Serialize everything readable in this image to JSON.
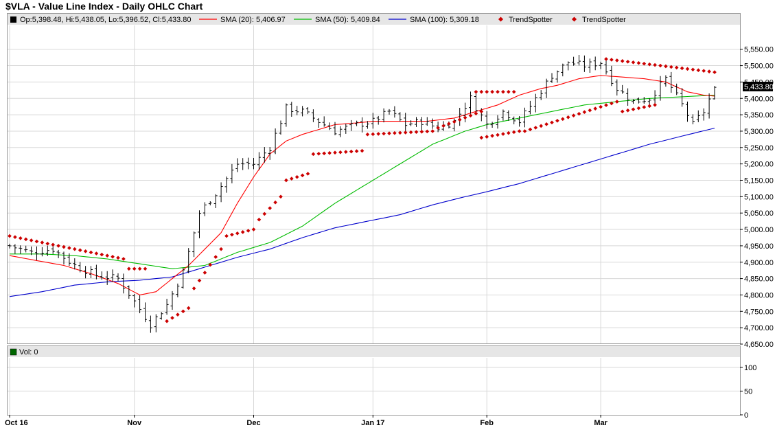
{
  "title": "$VLA - Value Line Index - Daily OHLC Chart",
  "colors": {
    "sma20": "#ff0000",
    "sma50": "#00bb00",
    "sma100": "#0000cc",
    "trendspotter": "#cc0000",
    "ohlc": "#000000",
    "grid": "#d8d8d8",
    "legend_bg": "#e6e6e6",
    "last_badge": "#000000"
  },
  "legend": {
    "ohlc": "Op:5,398.48, Hi:5,438.05, Lo:5,396.52, Cl:5,433.80",
    "sma20": "SMA (20): 5,406.97",
    "sma50": "SMA (50): 5,409.84",
    "sma100": "SMA (100): 5,309.18",
    "trend1": "TrendSpotter",
    "trend2": "TrendSpotter"
  },
  "volume_legend": "Vol: 0",
  "last_price_label": "5,433.80",
  "chart_data": {
    "type": "line",
    "price_axis": {
      "ylim": [
        4650,
        5600
      ],
      "ticks": [
        "4,650.00",
        "4,700.00",
        "4,750.00",
        "4,800.00",
        "4,850.00",
        "4,900.00",
        "4,950.00",
        "5,000.00",
        "5,050.00",
        "5,100.00",
        "5,150.00",
        "5,200.00",
        "5,250.00",
        "5,300.00",
        "5,350.00",
        "5,400.00",
        "5,450.00",
        "5,500.00",
        "5,550.00"
      ]
    },
    "volume_axis": {
      "ylim": [
        0,
        120
      ],
      "ticks": [
        "0",
        "50",
        "100"
      ]
    },
    "x_months": [
      {
        "label": "Oct 16",
        "bar": 0
      },
      {
        "label": "Nov",
        "bar": 23
      },
      {
        "label": "Dec",
        "bar": 45
      },
      {
        "label": "Jan 17",
        "bar": 67
      },
      {
        "label": "Feb",
        "bar": 88
      },
      {
        "label": "Mar",
        "bar": 109
      }
    ],
    "bar_count": 131,
    "close_anchors": [
      [
        0,
        4950
      ],
      [
        4,
        4930
      ],
      [
        8,
        4940
      ],
      [
        12,
        4890
      ],
      [
        16,
        4860
      ],
      [
        20,
        4850
      ],
      [
        23,
        4780
      ],
      [
        26,
        4710
      ],
      [
        29,
        4770
      ],
      [
        32,
        4870
      ],
      [
        35,
        5050
      ],
      [
        38,
        5110
      ],
      [
        42,
        5200
      ],
      [
        45,
        5200
      ],
      [
        48,
        5250
      ],
      [
        51,
        5370
      ],
      [
        54,
        5360
      ],
      [
        57,
        5330
      ],
      [
        60,
        5300
      ],
      [
        64,
        5320
      ],
      [
        67,
        5330
      ],
      [
        70,
        5360
      ],
      [
        73,
        5320
      ],
      [
        76,
        5330
      ],
      [
        79,
        5310
      ],
      [
        82,
        5330
      ],
      [
        85,
        5400
      ],
      [
        88,
        5320
      ],
      [
        91,
        5360
      ],
      [
        94,
        5330
      ],
      [
        97,
        5400
      ],
      [
        100,
        5470
      ],
      [
        103,
        5510
      ],
      [
        106,
        5500
      ],
      [
        109,
        5510
      ],
      [
        112,
        5430
      ],
      [
        115,
        5390
      ],
      [
        118,
        5400
      ],
      [
        121,
        5460
      ],
      [
        124,
        5380
      ],
      [
        126,
        5320
      ],
      [
        128,
        5360
      ],
      [
        130,
        5433.8
      ]
    ],
    "sma20": {
      "name": "SMA (20)",
      "values": [
        [
          0,
          4920
        ],
        [
          5,
          4905
        ],
        [
          10,
          4890
        ],
        [
          15,
          4865
        ],
        [
          20,
          4835
        ],
        [
          24,
          4800
        ],
        [
          27,
          4810
        ],
        [
          30,
          4850
        ],
        [
          33,
          4890
        ],
        [
          36,
          4940
        ],
        [
          39,
          4990
        ],
        [
          42,
          5080
        ],
        [
          45,
          5160
        ],
        [
          48,
          5230
        ],
        [
          51,
          5270
        ],
        [
          54,
          5290
        ],
        [
          57,
          5305
        ],
        [
          60,
          5320
        ],
        [
          64,
          5325
        ],
        [
          67,
          5330
        ],
        [
          72,
          5330
        ],
        [
          77,
          5330
        ],
        [
          82,
          5340
        ],
        [
          86,
          5360
        ],
        [
          90,
          5380
        ],
        [
          94,
          5410
        ],
        [
          98,
          5430
        ],
        [
          101,
          5440
        ],
        [
          105,
          5460
        ],
        [
          109,
          5470
        ],
        [
          113,
          5465
        ],
        [
          117,
          5460
        ],
        [
          121,
          5450
        ],
        [
          125,
          5420
        ],
        [
          128,
          5410
        ],
        [
          130,
          5406.97
        ]
      ]
    },
    "sma50": {
      "name": "SMA (50)",
      "values": [
        [
          0,
          4925
        ],
        [
          6,
          4925
        ],
        [
          12,
          4920
        ],
        [
          18,
          4910
        ],
        [
          24,
          4895
        ],
        [
          30,
          4880
        ],
        [
          36,
          4890
        ],
        [
          42,
          4930
        ],
        [
          48,
          4960
        ],
        [
          54,
          5010
        ],
        [
          60,
          5080
        ],
        [
          66,
          5140
        ],
        [
          72,
          5200
        ],
        [
          78,
          5260
        ],
        [
          84,
          5300
        ],
        [
          88,
          5320
        ],
        [
          94,
          5340
        ],
        [
          100,
          5360
        ],
        [
          106,
          5380
        ],
        [
          112,
          5390
        ],
        [
          118,
          5400
        ],
        [
          124,
          5405
        ],
        [
          130,
          5409.84
        ]
      ]
    },
    "sma100": {
      "name": "SMA (100)",
      "values": [
        [
          0,
          4795
        ],
        [
          6,
          4810
        ],
        [
          12,
          4830
        ],
        [
          18,
          4840
        ],
        [
          24,
          4845
        ],
        [
          30,
          4855
        ],
        [
          36,
          4885
        ],
        [
          42,
          4915
        ],
        [
          48,
          4940
        ],
        [
          54,
          4975
        ],
        [
          60,
          5005
        ],
        [
          66,
          5025
        ],
        [
          72,
          5045
        ],
        [
          78,
          5075
        ],
        [
          84,
          5100
        ],
        [
          88,
          5115
        ],
        [
          94,
          5140
        ],
        [
          100,
          5170
        ],
        [
          106,
          5200
        ],
        [
          112,
          5230
        ],
        [
          118,
          5260
        ],
        [
          124,
          5285
        ],
        [
          130,
          5309.18
        ]
      ]
    },
    "trendspotter": {
      "name": "TrendSpotter",
      "segments": [
        [
          0,
          21,
          4980,
          4910
        ],
        [
          22,
          25,
          4880,
          4880
        ],
        [
          29,
          33,
          4720,
          4760
        ],
        [
          34,
          39,
          4820,
          4940
        ],
        [
          40,
          45,
          4980,
          5000
        ],
        [
          46,
          50,
          5030,
          5100
        ],
        [
          51,
          55,
          5150,
          5170
        ],
        [
          56,
          65,
          5230,
          5240
        ],
        [
          66,
          78,
          5290,
          5300
        ],
        [
          79,
          87,
          5310,
          5360
        ],
        [
          86,
          93,
          5420,
          5420
        ],
        [
          87,
          94,
          5280,
          5300
        ],
        [
          95,
          112,
          5300,
          5390
        ],
        [
          113,
          119,
          5360,
          5380
        ],
        [
          110,
          130,
          5520,
          5480
        ]
      ]
    }
  }
}
